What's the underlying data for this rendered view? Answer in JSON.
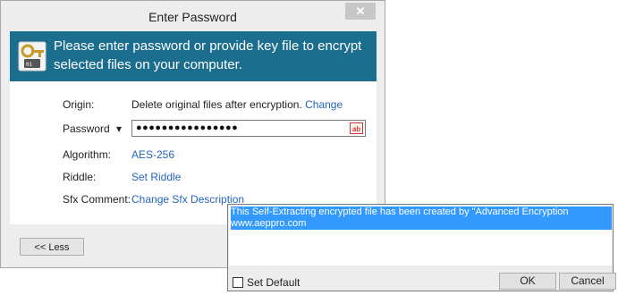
{
  "dialog": {
    "title": "Enter Password",
    "close_label": "✕",
    "banner": {
      "text": "Please enter password or provide key file to encrypt selected files on your computer."
    },
    "fields": {
      "origin_label": "Origin:",
      "origin_value": "Delete original files after encryption.",
      "origin_link": "Change",
      "password_label": "Password",
      "password_dropdown": "▾",
      "password_value": "●●●●●●●●●●●●●●●●",
      "spell_icon_text": "ab",
      "algorithm_label": "Algorithm:",
      "algorithm_value": "AES-256",
      "riddle_label": "Riddle:",
      "riddle_value": "Set Riddle",
      "sfx_label": "Sfx Comment:",
      "sfx_value": "Change Sfx Description"
    },
    "footer": {
      "less_button": "<< Less"
    }
  },
  "popup": {
    "text_line1": "This Self-Extracting encrypted file has been created by \"Advanced Encryption Package\"",
    "text_line2": "www.aeppro.com",
    "set_default_label": "Set Default",
    "set_default_checked": false,
    "ok_button": "OK",
    "cancel_button": "Cancel"
  },
  "colors": {
    "banner_bg": "#1b6e8e",
    "link": "#2266bb",
    "selection": "#3399ff"
  }
}
